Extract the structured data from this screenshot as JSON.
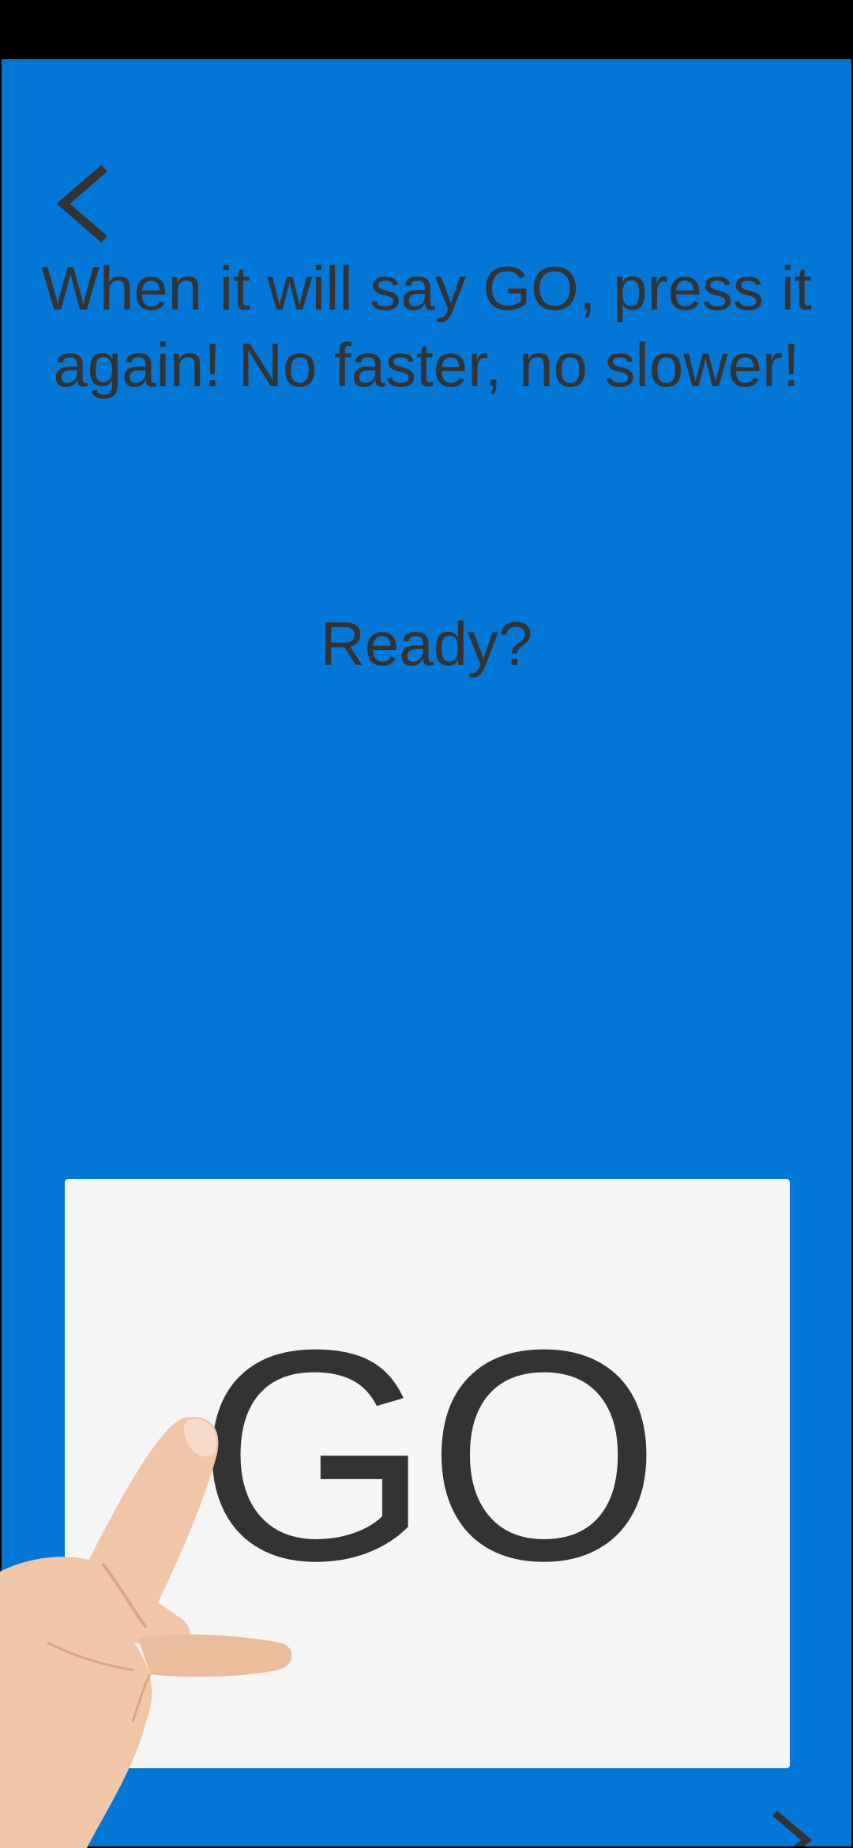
{
  "icons": {
    "back": "chevron-left-icon",
    "next": "chevron-right-icon",
    "hand": "pointing-hand-illustration"
  },
  "colors": {
    "background": "#0277d6",
    "card": "#f5f5f5",
    "text": "#333333",
    "skin": "#f0c6a8"
  },
  "instruction": {
    "line1": "When it will say GO, press it",
    "line2": "again! No faster, no slower!"
  },
  "prompt": "Ready?",
  "go_button": {
    "label": "GO"
  }
}
